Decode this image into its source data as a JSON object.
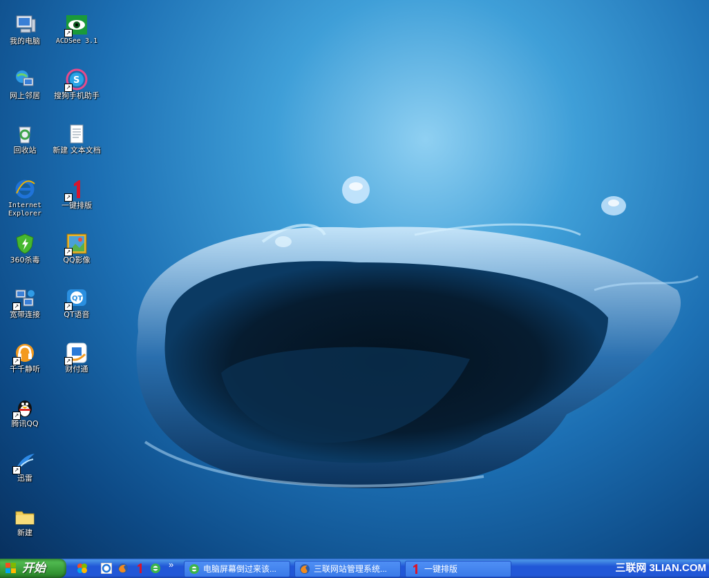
{
  "desktop": {
    "icons_col1": [
      {
        "label": "我的电脑"
      },
      {
        "label": "网上邻居"
      },
      {
        "label": "回收站"
      },
      {
        "label": "Internet Explorer"
      },
      {
        "label": "360杀毒"
      },
      {
        "label": "宽带连接"
      },
      {
        "label": "千千静听"
      },
      {
        "label": "腾讯QQ"
      },
      {
        "label": "迅雷"
      },
      {
        "label": "新建"
      }
    ],
    "icons_col2": [
      {
        "label": "ACDSee 3.1"
      },
      {
        "label": "搜狗手机助手"
      },
      {
        "label": "新建 文本文档"
      },
      {
        "label": "一键排版"
      },
      {
        "label": "QQ影像"
      },
      {
        "label": "QT语音"
      },
      {
        "label": "财付通"
      }
    ]
  },
  "taskbar": {
    "start_label": "开始",
    "quicklaunch_overflow": "»",
    "tasks": [
      {
        "label": "电脑屏幕倒过来该..."
      },
      {
        "label": "三联网站管理系统..."
      },
      {
        "label": "一键排版"
      }
    ],
    "watermark": "三联网 3LIAN.COM"
  },
  "colors": {
    "taskbar_blue": "#2157d7",
    "start_green": "#3c9a3c"
  }
}
